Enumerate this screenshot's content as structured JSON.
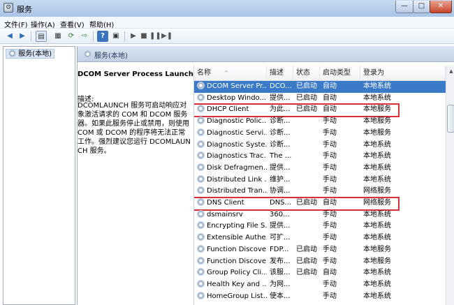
{
  "window": {
    "title": "服务",
    "app_icon": "services-icon",
    "buttons": {
      "minimize": "—",
      "maximize": "□",
      "close": "✕"
    }
  },
  "menu": [
    "文件(F)",
    "操作(A)",
    "查看(V)",
    "帮助(H)"
  ],
  "toolbar": {
    "icons": [
      "back-icon",
      "forward-icon",
      "show-tree-icon",
      "properties-icon",
      "refresh-icon",
      "export-icon",
      "help-icon",
      "details-icon",
      "start-icon",
      "stop-icon",
      "pause-icon",
      "restart-icon"
    ]
  },
  "tree": {
    "root_label": "服务(本地)"
  },
  "main": {
    "header_title": "服务(本地)",
    "description": {
      "service_name": "DCOM Server Process Launcher",
      "label": "描述:",
      "text": "DCOMLAUNCH 服务可启动响应对象激活请求的 COM 和 DCOM 服务器。如果此服务停止或禁用，则使用 COM 或 DCOM 的程序将无法正常工作。强烈建议您运行 DCOMLAUNCH 服务。"
    },
    "columns": [
      "名称",
      "描述",
      "状态",
      "启动类型",
      "登录为"
    ],
    "rows": [
      {
        "name": "DCOM Server Pr...",
        "desc": "DCO...",
        "status": "已启动",
        "startup": "自动",
        "logon": "本地系统",
        "selected": true
      },
      {
        "name": "Desktop Windo...",
        "desc": "提供...",
        "status": "已启动",
        "startup": "自动",
        "logon": "本地系统"
      },
      {
        "name": "DHCP Client",
        "desc": "为此...",
        "status": "已启动",
        "startup": "自动",
        "logon": "本地服务",
        "highlighted": true
      },
      {
        "name": "Diagnostic Polic...",
        "desc": "诊断...",
        "status": "",
        "startup": "手动",
        "logon": "本地服务"
      },
      {
        "name": "Diagnostic Servi...",
        "desc": "诊断...",
        "status": "",
        "startup": "手动",
        "logon": "本地服务"
      },
      {
        "name": "Diagnostic Syste...",
        "desc": "诊断...",
        "status": "",
        "startup": "手动",
        "logon": "本地系统"
      },
      {
        "name": "Diagnostics Trac...",
        "desc": "The ...",
        "status": "",
        "startup": "手动",
        "logon": "本地系统"
      },
      {
        "name": "Disk Defragmen...",
        "desc": "提供...",
        "status": "",
        "startup": "手动",
        "logon": "本地系统"
      },
      {
        "name": "Distributed Link ...",
        "desc": "维护...",
        "status": "",
        "startup": "手动",
        "logon": "本地系统"
      },
      {
        "name": "Distributed Tran...",
        "desc": "协调...",
        "status": "",
        "startup": "手动",
        "logon": "网络服务"
      },
      {
        "name": "DNS Client",
        "desc": "DNS...",
        "status": "已启动",
        "startup": "自动",
        "logon": "网络服务",
        "highlighted": true
      },
      {
        "name": "dsmainsrv",
        "desc": "360...",
        "status": "",
        "startup": "手动",
        "logon": "本地系统"
      },
      {
        "name": "Encrypting File S...",
        "desc": "提供...",
        "status": "",
        "startup": "手动",
        "logon": "本地系统"
      },
      {
        "name": "Extensible Authe...",
        "desc": "可扩...",
        "status": "",
        "startup": "手动",
        "logon": "本地系统"
      },
      {
        "name": "Function Discove...",
        "desc": "FDP...",
        "status": "已启动",
        "startup": "手动",
        "logon": "本地服务"
      },
      {
        "name": "Function Discove...",
        "desc": "发布...",
        "status": "已启动",
        "startup": "手动",
        "logon": "本地服务"
      },
      {
        "name": "Group Policy Cli...",
        "desc": "该服...",
        "status": "已启动",
        "startup": "自动",
        "logon": "本地系统"
      },
      {
        "name": "Health Key and ...",
        "desc": "为网...",
        "status": "",
        "startup": "手动",
        "logon": "本地系统"
      },
      {
        "name": "HomeGroup List...",
        "desc": "使本...",
        "status": "",
        "startup": "手动",
        "logon": "本地系统"
      }
    ]
  },
  "colors": {
    "selection": "#3b7ac7",
    "highlight_box": "#d9303a"
  }
}
